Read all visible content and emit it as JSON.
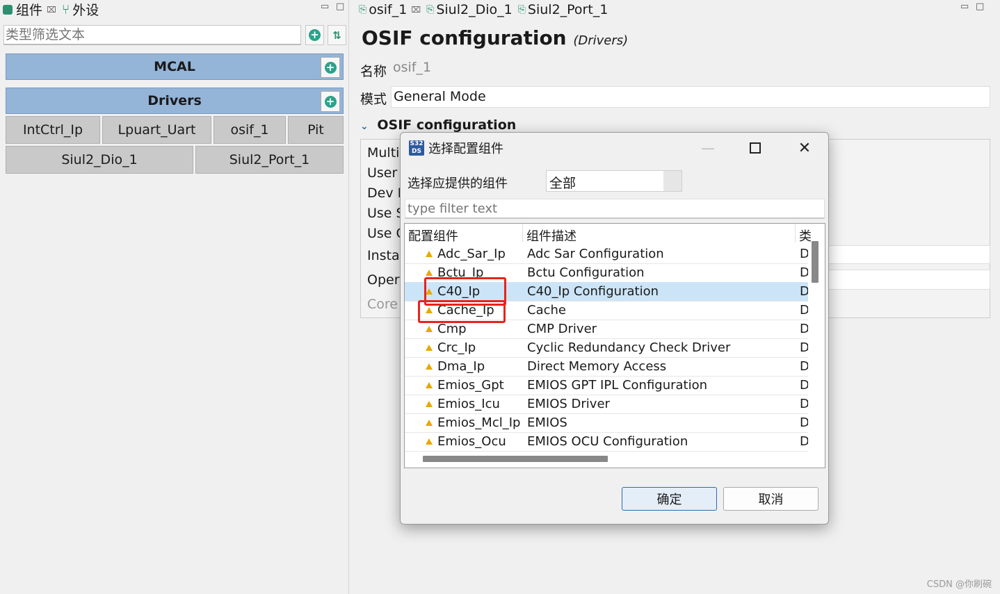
{
  "left_panel": {
    "tabs": [
      {
        "label": "组件",
        "close": "⌧"
      },
      {
        "label": "外设"
      }
    ],
    "filter_placeholder": "类型筛选文本",
    "groups": [
      {
        "label": "MCAL"
      },
      {
        "label": "Drivers"
      }
    ],
    "components_row1": [
      "IntCtrl_Ip",
      "Lpuart_Uart",
      "osif_1",
      "Pit"
    ],
    "components_row2": [
      "Siul2_Dio_1",
      "Siul2_Port_1"
    ]
  },
  "editor": {
    "tabs": [
      {
        "label": "osif_1",
        "close": "⌧"
      },
      {
        "label": "Siul2_Dio_1"
      },
      {
        "label": "Siul2_Port_1"
      }
    ],
    "title": "OSIF configuration",
    "title_sub": "(Drivers)",
    "name_label": "名称",
    "name_value": "osif_1",
    "mode_label": "模式",
    "mode_value": "General Mode",
    "section_title": "OSIF configuration",
    "section_rows": [
      "Multi",
      "User I",
      "Dev E",
      "Use S",
      "Use C",
      "Instar",
      "Opera",
      "Core"
    ]
  },
  "dialog": {
    "title": "选择配置组件",
    "app_icon_text": "S32 DS",
    "provided_label": "选择应提供的组件",
    "provided_value": "全部",
    "filter_placeholder": "type filter text",
    "columns": [
      "配置组件",
      "组件描述",
      "类"
    ],
    "rows": [
      {
        "name": "Adc_Sar_Ip",
        "desc": "Adc Sar Configuration",
        "type": "D"
      },
      {
        "name": "Bctu_Ip",
        "desc": "Bctu Configuration",
        "type": "D"
      },
      {
        "name": "C40_Ip",
        "desc": "C40_Ip Configuration",
        "type": "D"
      },
      {
        "name": "Cache_Ip",
        "desc": "Cache",
        "type": "D"
      },
      {
        "name": "Cmp",
        "desc": "CMP Driver",
        "type": "D"
      },
      {
        "name": "Crc_Ip",
        "desc": "Cyclic Redundancy Check Driver",
        "type": "D"
      },
      {
        "name": "Dma_Ip",
        "desc": "Direct Memory Access",
        "type": "D"
      },
      {
        "name": "Emios_Gpt",
        "desc": "EMIOS GPT IPL Configuration",
        "type": "D"
      },
      {
        "name": "Emios_Icu",
        "desc": "EMIOS Driver",
        "type": "D"
      },
      {
        "name": "Emios_Mcl_Ip",
        "desc": "EMIOS",
        "type": "D"
      },
      {
        "name": "Emios_Ocu",
        "desc": "EMIOS OCU Configuration",
        "type": "D"
      }
    ],
    "selected_row": "C40_Ip",
    "ok_label": "确定",
    "cancel_label": "取消"
  },
  "watermark": "CSDN @你刷碗",
  "colors": {
    "group_bar": "#94b4d8",
    "component_button": "#c9c9c9",
    "selected_row": "#cce4f7",
    "warning_icon": "#e8a800",
    "annotation_box": "#e8231a",
    "add_icon": "#2aa38a"
  }
}
